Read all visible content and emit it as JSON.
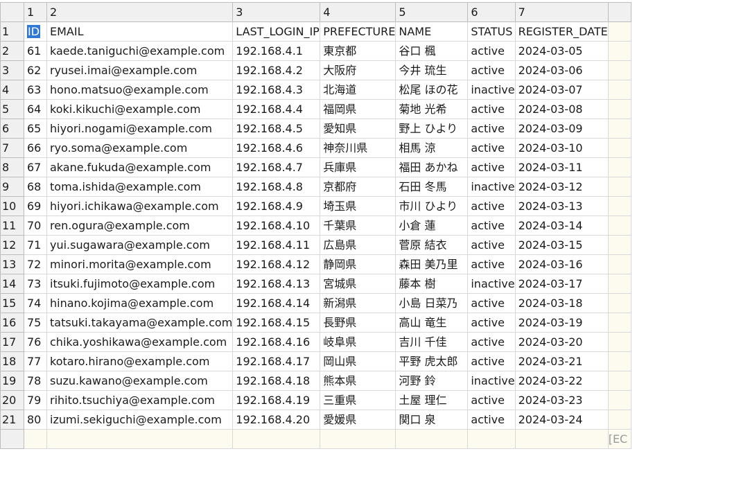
{
  "column_numbers": [
    "1",
    "2",
    "3",
    "4",
    "5",
    "6",
    "7"
  ],
  "rows": [
    {
      "n": "1",
      "cells": [
        "ID",
        "EMAIL",
        "LAST_LOGIN_IP",
        "PREFECTURE",
        "NAME",
        "STATUS",
        "REGISTER_DATE"
      ]
    },
    {
      "n": "2",
      "cells": [
        "61",
        "kaede.taniguchi@example.com",
        "192.168.4.1",
        "東京都",
        "谷口 楓",
        "active",
        "2024-03-05"
      ]
    },
    {
      "n": "3",
      "cells": [
        "62",
        "ryusei.imai@example.com",
        "192.168.4.2",
        "大阪府",
        "今井 琉生",
        "active",
        "2024-03-06"
      ]
    },
    {
      "n": "4",
      "cells": [
        "63",
        "hono.matsuo@example.com",
        "192.168.4.3",
        "北海道",
        "松尾 ほの花",
        "inactive",
        "2024-03-07"
      ]
    },
    {
      "n": "5",
      "cells": [
        "64",
        "koki.kikuchi@example.com",
        "192.168.4.4",
        "福岡県",
        "菊地 光希",
        "active",
        "2024-03-08"
      ]
    },
    {
      "n": "6",
      "cells": [
        "65",
        "hiyori.nogami@example.com",
        "192.168.4.5",
        "愛知県",
        "野上 ひより",
        "active",
        "2024-03-09"
      ]
    },
    {
      "n": "7",
      "cells": [
        "66",
        "ryo.soma@example.com",
        "192.168.4.6",
        "神奈川県",
        "相馬 涼",
        "active",
        "2024-03-10"
      ]
    },
    {
      "n": "8",
      "cells": [
        "67",
        "akane.fukuda@example.com",
        "192.168.4.7",
        "兵庫県",
        "福田 あかね",
        "active",
        "2024-03-11"
      ]
    },
    {
      "n": "9",
      "cells": [
        "68",
        "toma.ishida@example.com",
        "192.168.4.8",
        "京都府",
        "石田 冬馬",
        "inactive",
        "2024-03-12"
      ]
    },
    {
      "n": "10",
      "cells": [
        "69",
        "hiyori.ichikawa@example.com",
        "192.168.4.9",
        "埼玉県",
        "市川 ひより",
        "active",
        "2024-03-13"
      ]
    },
    {
      "n": "11",
      "cells": [
        "70",
        "ren.ogura@example.com",
        "192.168.4.10",
        "千葉県",
        "小倉 蓮",
        "active",
        "2024-03-14"
      ]
    },
    {
      "n": "12",
      "cells": [
        "71",
        "yui.sugawara@example.com",
        "192.168.4.11",
        "広島県",
        "菅原 結衣",
        "active",
        "2024-03-15"
      ]
    },
    {
      "n": "13",
      "cells": [
        "72",
        "minori.morita@example.com",
        "192.168.4.12",
        "静岡県",
        "森田 美乃里",
        "active",
        "2024-03-16"
      ]
    },
    {
      "n": "14",
      "cells": [
        "73",
        "itsuki.fujimoto@example.com",
        "192.168.4.13",
        "宮城県",
        "藤本 樹",
        "inactive",
        "2024-03-17"
      ]
    },
    {
      "n": "15",
      "cells": [
        "74",
        "hinano.kojima@example.com",
        "192.168.4.14",
        "新潟県",
        "小島 日菜乃",
        "active",
        "2024-03-18"
      ]
    },
    {
      "n": "16",
      "cells": [
        "75",
        "tatsuki.takayama@example.com",
        "192.168.4.15",
        "長野県",
        "高山 竜生",
        "active",
        "2024-03-19"
      ]
    },
    {
      "n": "17",
      "cells": [
        "76",
        "chika.yoshikawa@example.com",
        "192.168.4.16",
        "岐阜県",
        "吉川 千佳",
        "active",
        "2024-03-20"
      ]
    },
    {
      "n": "18",
      "cells": [
        "77",
        "kotaro.hirano@example.com",
        "192.168.4.17",
        "岡山県",
        "平野 虎太郎",
        "active",
        "2024-03-21"
      ]
    },
    {
      "n": "19",
      "cells": [
        "78",
        "suzu.kawano@example.com",
        "192.168.4.18",
        "熊本県",
        "河野 鈴",
        "inactive",
        "2024-03-22"
      ]
    },
    {
      "n": "20",
      "cells": [
        "79",
        "rihito.tsuchiya@example.com",
        "192.168.4.19",
        "三重県",
        "土屋 理仁",
        "active",
        "2024-03-23"
      ]
    },
    {
      "n": "21",
      "cells": [
        "80",
        "izumi.sekiguchi@example.com",
        "192.168.4.20",
        "愛媛県",
        "関口 泉",
        "active",
        "2024-03-24"
      ]
    }
  ],
  "truncated_cell": "[EC",
  "colors": {
    "selection": "#2f78d6",
    "header_bg": "#f0f0f0",
    "empty_area": "#fdfbef"
  }
}
